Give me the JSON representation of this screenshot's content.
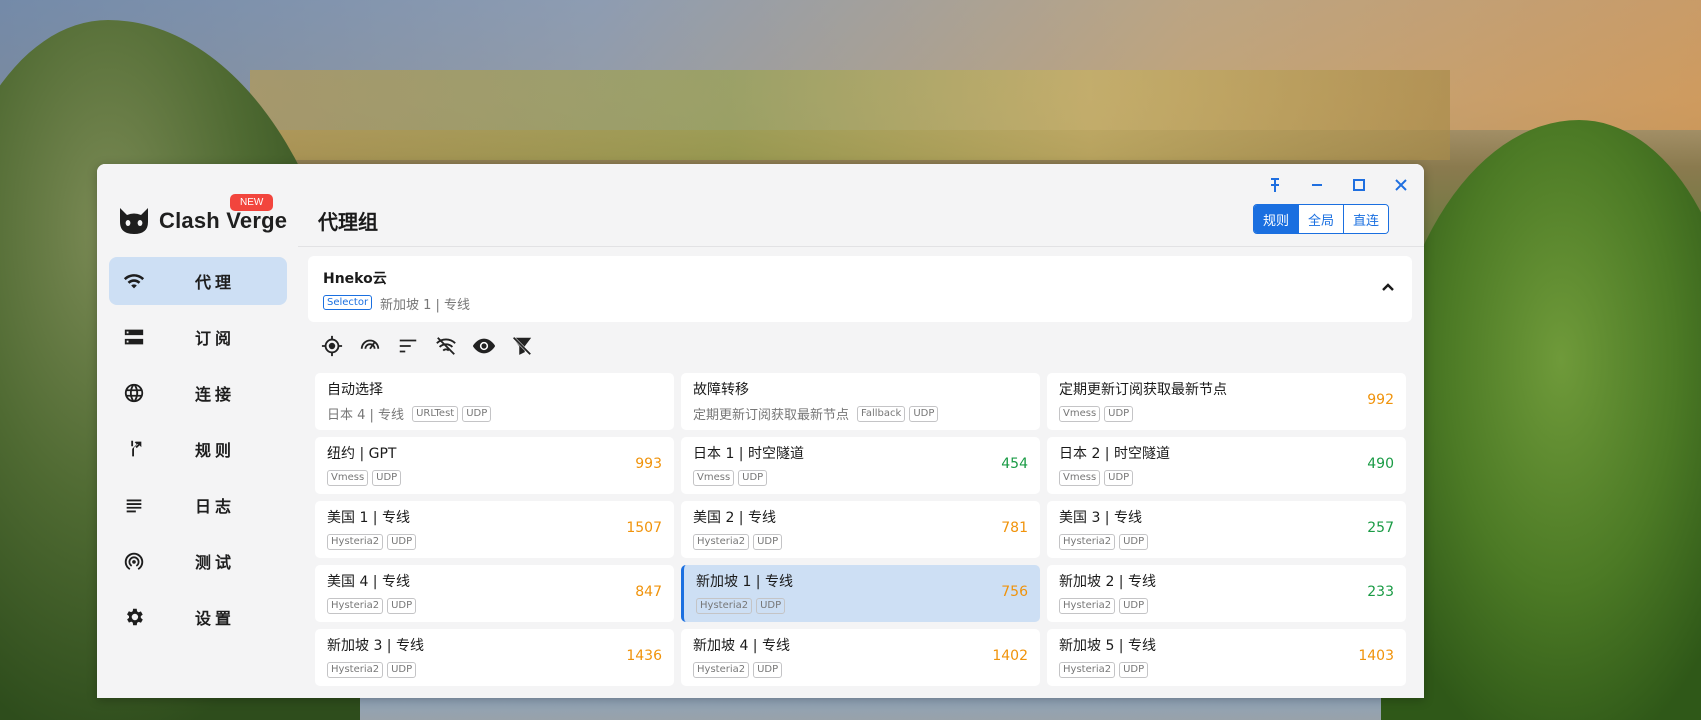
{
  "app": {
    "brand": "Clash Verge",
    "new_badge": "NEW"
  },
  "sidebar": {
    "items": [
      {
        "label": "代理",
        "icon": "wifi-icon",
        "active": true
      },
      {
        "label": "订阅",
        "icon": "storage-icon",
        "active": false
      },
      {
        "label": "连接",
        "icon": "globe-icon",
        "active": false
      },
      {
        "label": "规则",
        "icon": "fork-arrow-icon",
        "active": false
      },
      {
        "label": "日志",
        "icon": "lines-icon",
        "active": false
      },
      {
        "label": "测试",
        "icon": "broadcast-icon",
        "active": false
      },
      {
        "label": "设置",
        "icon": "gear-icon",
        "active": false
      }
    ]
  },
  "header": {
    "title": "代理组",
    "modes": [
      {
        "label": "规则",
        "active": true
      },
      {
        "label": "全局",
        "active": false
      },
      {
        "label": "直连",
        "active": false
      }
    ]
  },
  "group": {
    "name": "Hneko云",
    "type": "Selector",
    "current": "新加坡 1 | 专线"
  },
  "toolbar": [
    "locate-icon",
    "speed-test-icon",
    "sort-icon",
    "hide-unavailable-icon",
    "visibility-icon",
    "filter-off-icon"
  ],
  "colors": {
    "accent": "#1a6fe0",
    "delay_orange": "#f0930b",
    "delay_green": "#1a9b45",
    "selected_bg": "#cddff4"
  },
  "proxies": [
    {
      "name": "自动选择",
      "sub": "日本 4 | 专线",
      "tags": [
        "URLTest",
        "UDP"
      ],
      "delay": "",
      "delay_color": ""
    },
    {
      "name": "故障转移",
      "sub": "定期更新订阅获取最新节点",
      "tags": [
        "Fallback",
        "UDP"
      ],
      "delay": "",
      "delay_color": ""
    },
    {
      "name": "定期更新订阅获取最新节点",
      "sub": "",
      "tags": [
        "Vmess",
        "UDP"
      ],
      "delay": "992",
      "delay_color": "orange"
    },
    {
      "name": "纽约 | GPT",
      "sub": "",
      "tags": [
        "Vmess",
        "UDP"
      ],
      "delay": "993",
      "delay_color": "orange"
    },
    {
      "name": "日本 1 | 时空隧道",
      "sub": "",
      "tags": [
        "Vmess",
        "UDP"
      ],
      "delay": "454",
      "delay_color": "green"
    },
    {
      "name": "日本 2 | 时空隧道",
      "sub": "",
      "tags": [
        "Vmess",
        "UDP"
      ],
      "delay": "490",
      "delay_color": "green"
    },
    {
      "name": "美国 1 | 专线",
      "sub": "",
      "tags": [
        "Hysteria2",
        "UDP"
      ],
      "delay": "1507",
      "delay_color": "orange"
    },
    {
      "name": "美国 2 | 专线",
      "sub": "",
      "tags": [
        "Hysteria2",
        "UDP"
      ],
      "delay": "781",
      "delay_color": "orange"
    },
    {
      "name": "美国 3 | 专线",
      "sub": "",
      "tags": [
        "Hysteria2",
        "UDP"
      ],
      "delay": "257",
      "delay_color": "green"
    },
    {
      "name": "美国 4 | 专线",
      "sub": "",
      "tags": [
        "Hysteria2",
        "UDP"
      ],
      "delay": "847",
      "delay_color": "orange"
    },
    {
      "name": "新加坡 1 | 专线",
      "sub": "",
      "tags": [
        "Hysteria2",
        "UDP"
      ],
      "delay": "756",
      "delay_color": "orange",
      "selected": true
    },
    {
      "name": "新加坡 2 | 专线",
      "sub": "",
      "tags": [
        "Hysteria2",
        "UDP"
      ],
      "delay": "233",
      "delay_color": "green"
    },
    {
      "name": "新加坡 3 | 专线",
      "sub": "",
      "tags": [
        "Hysteria2",
        "UDP"
      ],
      "delay": "1436",
      "delay_color": "orange"
    },
    {
      "name": "新加坡 4 | 专线",
      "sub": "",
      "tags": [
        "Hysteria2",
        "UDP"
      ],
      "delay": "1402",
      "delay_color": "orange"
    },
    {
      "name": "新加坡 5 | 专线",
      "sub": "",
      "tags": [
        "Hysteria2",
        "UDP"
      ],
      "delay": "1403",
      "delay_color": "orange"
    }
  ]
}
